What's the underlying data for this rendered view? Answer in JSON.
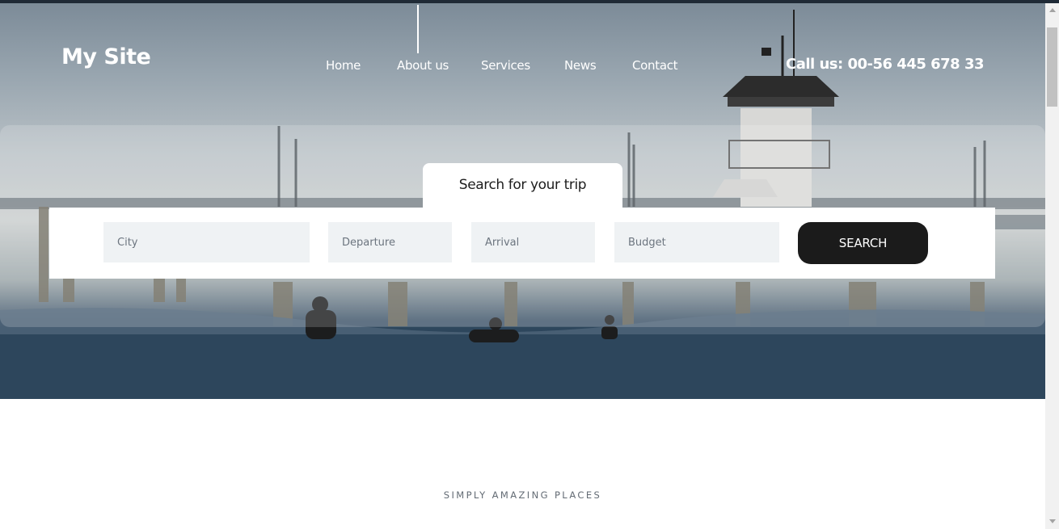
{
  "header": {
    "logo": "My Site",
    "nav": [
      {
        "label": "Home",
        "active": false
      },
      {
        "label": "About us",
        "active": true
      },
      {
        "label": "Services",
        "active": false
      },
      {
        "label": "News",
        "active": false
      },
      {
        "label": "Contact",
        "active": false
      }
    ],
    "call": "Call us: 00-56 445 678 33"
  },
  "search": {
    "tab_title": "Search for your trip",
    "fields": [
      {
        "placeholder": "City",
        "value": ""
      },
      {
        "placeholder": "Departure",
        "value": ""
      },
      {
        "placeholder": "Arrival",
        "value": ""
      },
      {
        "placeholder": "Budget",
        "value": ""
      }
    ],
    "button": "SEARCH"
  },
  "section": {
    "eyebrow": "SIMPLY AMAZING PLACES"
  },
  "colors": {
    "button_bg": "#1b1b1b",
    "field_bg": "#eff2f4",
    "text_on_hero": "#ffffff"
  },
  "icons": {
    "scroll_up": "scroll-up-arrow-icon",
    "scroll_down": "scroll-down-arrow-icon"
  }
}
